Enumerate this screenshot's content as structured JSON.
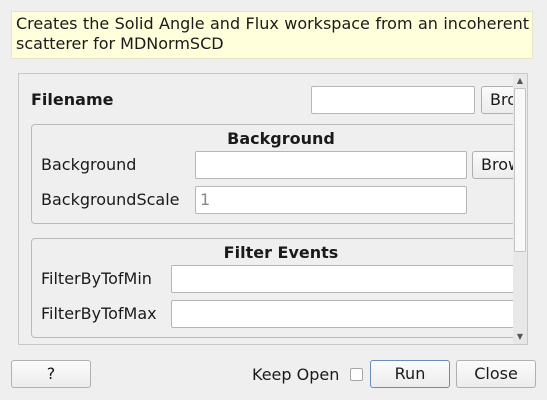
{
  "description": "Creates the Solid Angle and Flux workspace from an incoherent scatterer for MDNormSCD",
  "fields": {
    "filename": {
      "label": "Filename",
      "value": "",
      "browse_label": "Browse"
    },
    "background_group": {
      "title": "Background",
      "background": {
        "label": "Background",
        "value": "",
        "browse_label": "Browse"
      },
      "background_scale": {
        "label": "BackgroundScale",
        "value": "1"
      }
    },
    "filter_group": {
      "title": "Filter Events",
      "filter_min": {
        "label": "FilterByTofMin",
        "value": ""
      },
      "filter_max": {
        "label": "FilterByTofMax",
        "value": ""
      }
    }
  },
  "scrollbar": {
    "up_icon": "arrow-up-icon",
    "down_icon": "arrow-down-icon"
  },
  "footer": {
    "help_label": "?",
    "keep_open_label": "Keep Open",
    "keep_open_checked": false,
    "run_label": "Run",
    "close_label": "Close"
  }
}
